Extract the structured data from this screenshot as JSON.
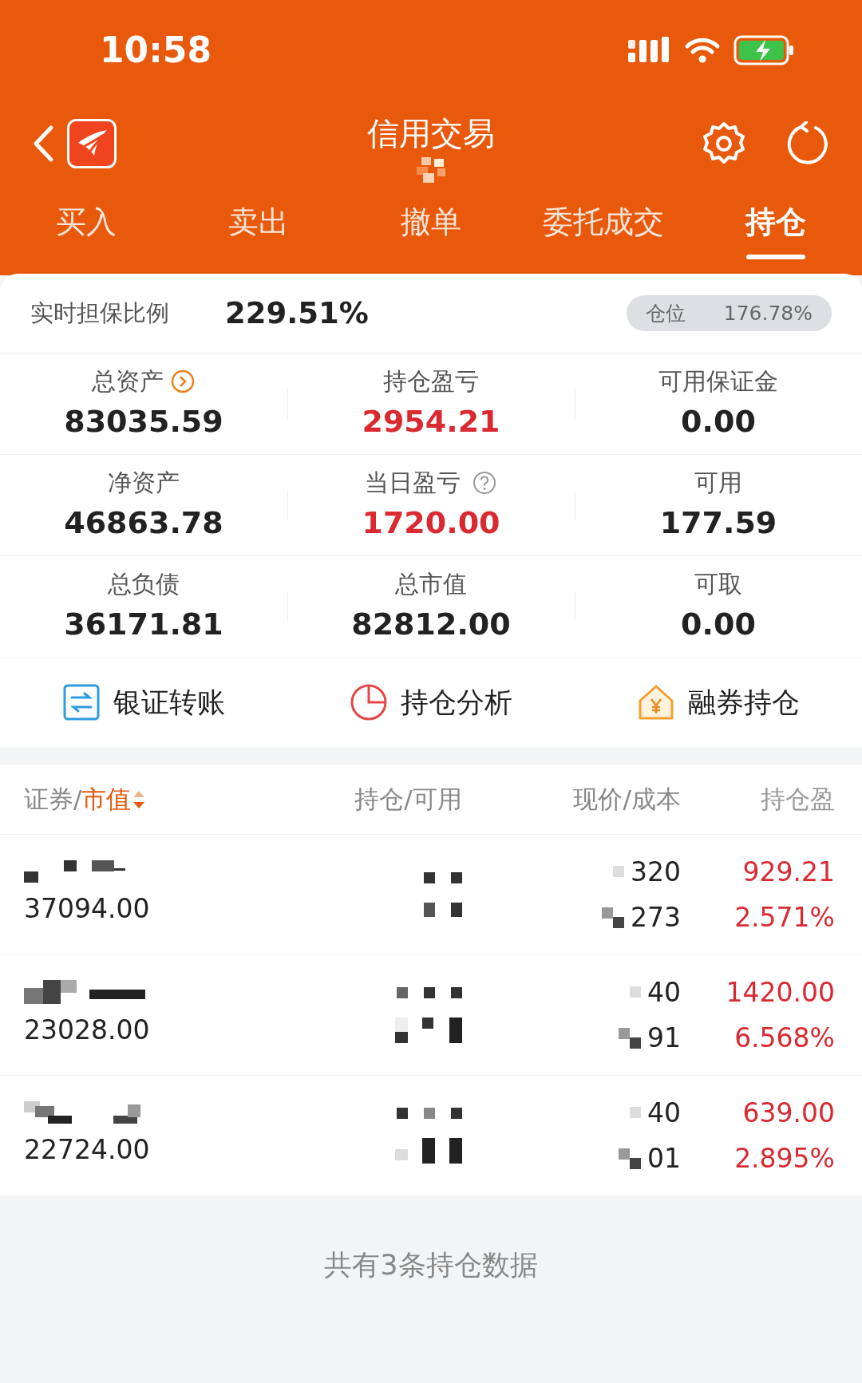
{
  "status_bar": {
    "time": "10:58"
  },
  "header": {
    "title": "信用交易"
  },
  "tabs": [
    {
      "label": "买入",
      "selected": false
    },
    {
      "label": "卖出",
      "selected": false
    },
    {
      "label": "撤单",
      "selected": false
    },
    {
      "label": "委托成交",
      "selected": false
    },
    {
      "label": "持仓",
      "selected": true
    }
  ],
  "ratio": {
    "label": "实时担保比例",
    "value": "229.51%",
    "position_label": "仓位",
    "position_value": "176.78%"
  },
  "metrics": [
    {
      "label": "总资产",
      "value": "83035.59",
      "kind": "plain"
    },
    {
      "label": "持仓盈亏",
      "value": "2954.21",
      "kind": "gain"
    },
    {
      "label": "可用保证金",
      "value": "0.00",
      "kind": "plain"
    },
    {
      "label": "净资产",
      "value": "46863.78",
      "kind": "plain"
    },
    {
      "label": "当日盈亏",
      "value": "1720.00",
      "kind": "gain"
    },
    {
      "label": "可用",
      "value": "177.59",
      "kind": "plain"
    },
    {
      "label": "总负债",
      "value": "36171.81",
      "kind": "plain"
    },
    {
      "label": "总市值",
      "value": "82812.00",
      "kind": "plain"
    },
    {
      "label": "可取",
      "value": "0.00",
      "kind": "plain"
    }
  ],
  "actions": [
    "银证转账",
    "持仓分析",
    "融券持仓"
  ],
  "table": {
    "columns": [
      {
        "label": "证券/",
        "sort_label": "市值",
        "sorted": true
      },
      {
        "label": "持仓/可用"
      },
      {
        "label": "现价/成本"
      },
      {
        "label": "持仓盈"
      }
    ],
    "rows": [
      {
        "market_value": "37094.00",
        "price": "320",
        "cost": "273",
        "pnl": "929.21",
        "pnl_pct": "2.571%"
      },
      {
        "market_value": "23028.00",
        "price": "40",
        "cost": "91",
        "pnl": "1420.00",
        "pnl_pct": "6.568%"
      },
      {
        "market_value": "22724.00",
        "price": "40",
        "cost": "01",
        "pnl": "639.00",
        "pnl_pct": "2.895%"
      }
    ]
  },
  "footer": "共有3条持仓数据"
}
